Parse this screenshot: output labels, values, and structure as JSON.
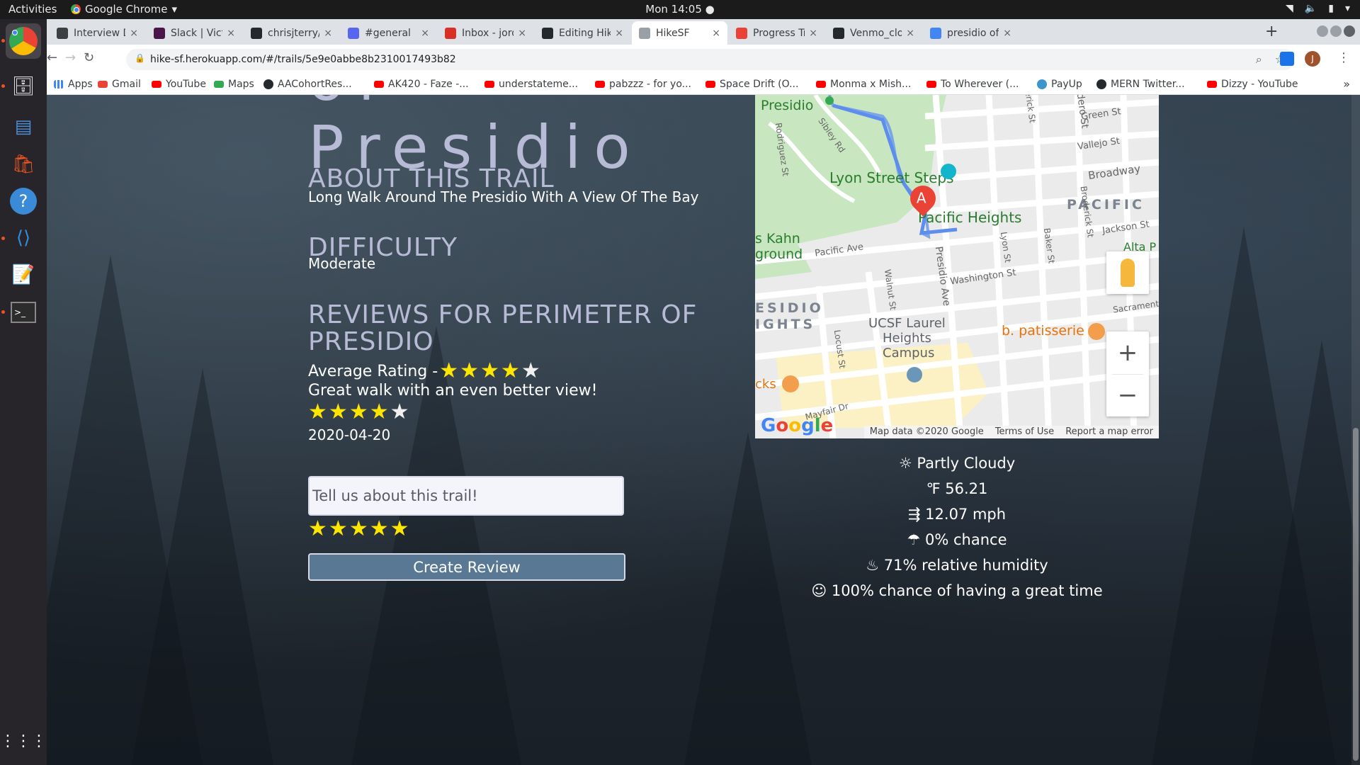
{
  "system": {
    "activities": "Activities",
    "app_menu": "Google Chrome",
    "clock": "Mon 14:05 ●"
  },
  "tabs": [
    {
      "title": "Interview Data",
      "favicon_color": "#3c4043"
    },
    {
      "title": "Slack | Victoria",
      "favicon_color": "#4a154b"
    },
    {
      "title": "chrisjterry/Hike",
      "favicon_color": "#24292e"
    },
    {
      "title": "#general",
      "favicon_color": "#5865f2"
    },
    {
      "title": "Inbox - jordan.t",
      "favicon_color": "#d93025"
    },
    {
      "title": "Editing HikeSF/",
      "favicon_color": "#24292e"
    },
    {
      "title": "HikeSF",
      "favicon_color": "#9aa0a6"
    },
    {
      "title": "Progress Track",
      "favicon_color": "#ea4335"
    },
    {
      "title": "Venmo_clone_",
      "favicon_color": "#24292e"
    },
    {
      "title": "presidio of san",
      "favicon_color": "#4285f4"
    }
  ],
  "url": "hike-sf.herokuapp.com/#/trails/5e9e0abbe8b2310017493b82",
  "avatar_initial": "J",
  "bookmarks": [
    {
      "label": "Apps",
      "icon": "apps"
    },
    {
      "label": "Gmail",
      "icon": "gmail"
    },
    {
      "label": "YouTube",
      "icon": "youtube"
    },
    {
      "label": "Maps",
      "icon": "maps"
    },
    {
      "label": "AACohortRes...",
      "icon": "github"
    },
    {
      "label": "AK420 - Faze -...",
      "icon": "youtube"
    },
    {
      "label": "understateme...",
      "icon": "youtube"
    },
    {
      "label": "pabzzz - for yo...",
      "icon": "youtube"
    },
    {
      "label": "Space Drift (O...",
      "icon": "youtube"
    },
    {
      "label": "Monma x Mish...",
      "icon": "youtube"
    },
    {
      "label": "To Wherever (...",
      "icon": "youtube"
    },
    {
      "label": "PayUp",
      "icon": "payup"
    },
    {
      "label": "MERN Twitter...",
      "icon": "github"
    },
    {
      "label": "Dizzy - YouTube",
      "icon": "youtube"
    }
  ],
  "trail": {
    "title_line1": "of",
    "title_line2": "Presidio",
    "about_heading": "ABOUT THIS TRAIL",
    "about_text": "Long Walk Around The Presidio With A View Of The Bay",
    "difficulty_heading": "DIFFICULTY",
    "difficulty_text": "Moderate",
    "reviews_heading": "REVIEWS FOR PERIMETER OF PRESIDIO",
    "average_label": "Average Rating -",
    "average_rating": 4
  },
  "reviews": [
    {
      "body": "Great walk with an even better view!",
      "rating": 4,
      "date": "2020-04-20"
    }
  ],
  "review_form": {
    "placeholder": "Tell us about this trail!",
    "rating": 5,
    "submit_label": "Create Review"
  },
  "map": {
    "labels": {
      "presidio": "Presidio",
      "lyon_steps": "Lyon Street Steps",
      "pacific_heights": "Pacific Heights",
      "pacific": "PACIFIC",
      "alta": "Alta P",
      "kahn": "s Kahn",
      "ground": "ground",
      "esidio": "ESIDIO",
      "ights": "IGHTS",
      "ucsf1": "UCSF Laurel",
      "ucsf2": "Heights",
      "ucsf3": "Campus",
      "patisserie": "b. patisserie",
      "cks": "cks",
      "sacramento": "Sacrament",
      "green_st": "Green St",
      "vallejo_st": "Vallejo St",
      "broadway": "Broadway",
      "jackson_st": "Jackson St",
      "pacific_ave": "Pacific Ave",
      "washington_st": "Washington St",
      "presidio_ave": "Presidio Ave",
      "lyon_st": "Lyon St",
      "baker_st": "Baker St",
      "broderick_st": "Broderick St",
      "walnut_st": "Walnut St",
      "locust_st": "Locust St",
      "mayfair_dr": "Mayfair Dr",
      "sibley_rd": "Sibley Rd",
      "rodriguez_st": "Rodriguez St",
      "erick_st": "erick St",
      "adero_st": "adero St",
      "marker": "A"
    },
    "attribution": [
      "Map data ©2020 Google",
      "Terms of Use",
      "Report a map error"
    ],
    "logo": "Google"
  },
  "weather": {
    "summary": "☼ Partly Cloudy",
    "temperature": "℉ 56.21",
    "wind": "⇶ 12.07 mph",
    "precip": "☂ 0% chance",
    "humidity": "♨ 71% relative humidity",
    "fun": "☺ 100% chance of having a great time"
  },
  "colors": {
    "heading": "#b7bbd6",
    "star_on": "#ffe600",
    "button": "#587893"
  }
}
